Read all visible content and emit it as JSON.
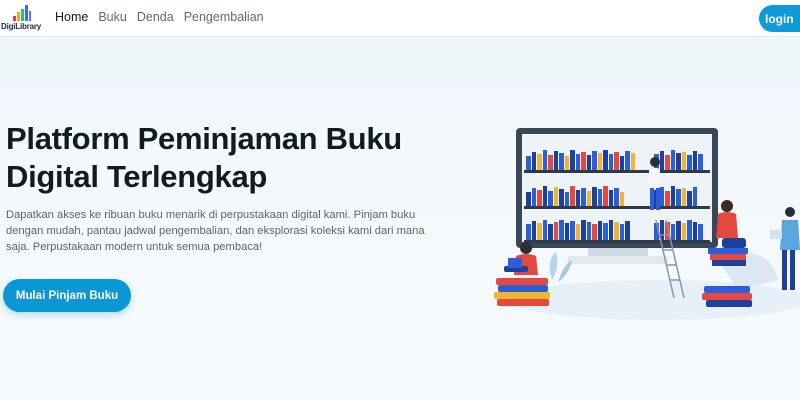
{
  "nav": {
    "brand": "DigiLibrary",
    "links": [
      {
        "label": "Home",
        "active": true
      },
      {
        "label": "Buku",
        "active": false
      },
      {
        "label": "Denda",
        "active": false
      },
      {
        "label": "Pengembalian",
        "active": false
      }
    ],
    "login_label": "login"
  },
  "hero": {
    "title_line1": "Platform Peminjaman Buku",
    "title_line2": "Digital Terlengkap",
    "description": "Dapatkan akses ke ribuan buku menarik di perpustakaan digital kami. Pinjam buku dengan mudah, pantau jadwal pengembalian, dan eksplorasi koleksi kami dari mana saja. Perpustakaan modern untuk semua pembaca!",
    "cta_label": "Mulai Pinjam Buku"
  },
  "colors": {
    "accent": "#0b96d4",
    "title": "#141a21",
    "monitor": "#3a4756"
  },
  "icons": {
    "brand": "bar-chart-logo-icon",
    "illustration": "library-monitor-illustration"
  }
}
